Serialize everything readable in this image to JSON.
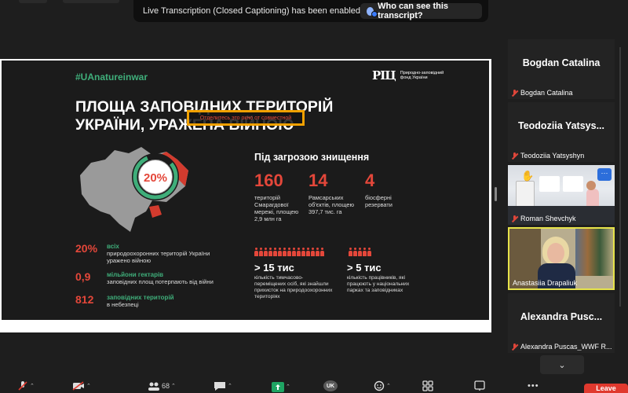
{
  "caption_banner": {
    "message": "Live Transcription (Closed Captioning) has been enabled",
    "who_button": "Who can see this transcript?"
  },
  "slide": {
    "hashtag": "#UAnatureinwar",
    "logo_mark": "РІЦ",
    "logo_text": "Природно-заповідний фонд України",
    "title_line1": "ПЛОЩА ЗАПОВІДНИХ ТЕРИТОРІЙ",
    "title_line2": "УКРАЇНИ, УРАЖЕНА ВІЙНОЮ",
    "overlay_text": "Отделитесь это окно от совместной",
    "map_percent": "20%",
    "threat_title": "Під загрозою знищення",
    "stats": [
      {
        "value": "160",
        "desc": "територій Смарагдової мережі, площею 2,9 млн га"
      },
      {
        "value": "14",
        "desc": "Рамсарських об'єктів, площею 397,7 тис. га"
      },
      {
        "value": "4",
        "desc": "біосферні резервати"
      }
    ],
    "left_stats": [
      {
        "value": "20%",
        "green": "всіх",
        "white": "природоохоронних територій України уражено війною"
      },
      {
        "value": "0,9",
        "green": "мільйони гектарів",
        "white": "заповідних площ потерпають від війни"
      },
      {
        "value": "812",
        "green": "заповідних територій",
        "white": "в небезпеці"
      }
    ],
    "mid_stats": [
      {
        "value": "> 15 тис",
        "desc": "кількість тимчасово-переміщених осіб, які знайшли прихисток на природоохоронних територіях"
      },
      {
        "value": "> 5 тис",
        "desc": "кількість працівників, які працюють у національних парках та заповідниках"
      }
    ]
  },
  "participants": [
    {
      "big_name": "Bogdan Catalina",
      "name": "Bogdan Catalina"
    },
    {
      "big_name": "Teodoziia Yatsys...",
      "name": "Teodoziia Yatsyshyn"
    },
    {
      "name": "Roman Shevchyk"
    },
    {
      "name": "Anastasiia Drapaliuk"
    },
    {
      "big_name": "Alexandra Pusc...",
      "name": "Alexandra Puscas_WWF R..."
    }
  ],
  "more_button": "···",
  "toolbar": {
    "participants_count": "68",
    "language_badge": "UK",
    "leave": "Leave"
  },
  "colors": {
    "accent_red": "#e4473a",
    "accent_green": "#3fae7a",
    "active_speaker_border": "#e6e34a",
    "leave_red": "#e0392e"
  }
}
